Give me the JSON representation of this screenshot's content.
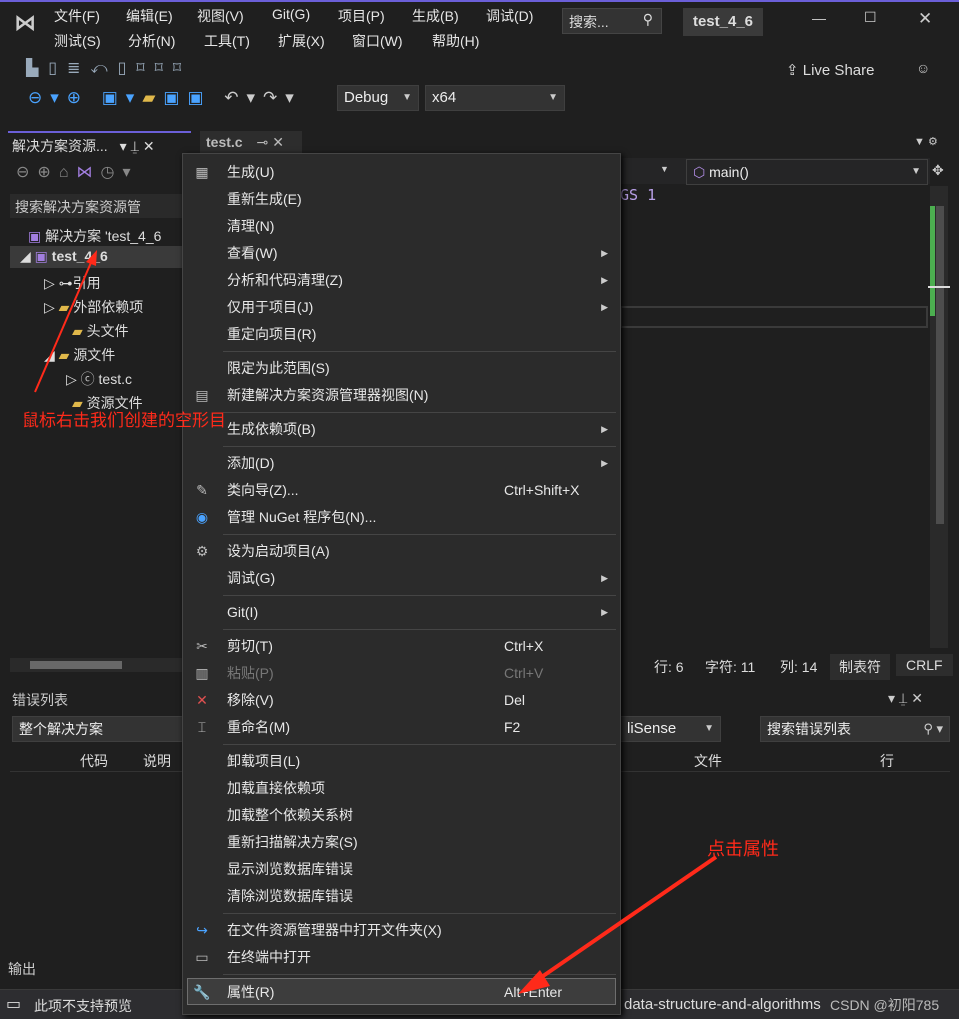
{
  "app": {
    "title": "test_4_6",
    "search_placeholder": "搜索...",
    "live_share": "Live Share"
  },
  "menubar": [
    "文件(F)",
    "编辑(E)",
    "视图(V)",
    "Git(G)",
    "项目(P)",
    "生成(B)",
    "调试(D)",
    "测试(S)",
    "分析(N)",
    "工具(T)",
    "扩展(X)",
    "窗口(W)",
    "帮助(H)"
  ],
  "toolbar": {
    "config": "Debug",
    "platform": "x64"
  },
  "solution_explorer": {
    "tab": "解决方案资源...",
    "search_placeholder": "搜索解决方案资源管",
    "items": [
      "解决方案 'test_4_6",
      "test_4_6",
      "引用",
      "外部依赖项",
      "头文件",
      "源文件",
      "test.c",
      "资源文件"
    ]
  },
  "editor": {
    "tab": "test.c",
    "nav_right": "main()",
    "code_fragment": "GS 1",
    "status": {
      "line": "行: 6",
      "char": "字符: 11",
      "col": "列: 14",
      "tabs": "制表符",
      "eol": "CRLF"
    }
  },
  "error_list": {
    "title": "错误列表",
    "scope": "整个解决方案",
    "source": "liSense",
    "search_placeholder": "搜索错误列表",
    "columns": [
      "代码",
      "说明",
      "文件",
      "行"
    ]
  },
  "output": {
    "title": "输出"
  },
  "statusbar": {
    "text": "此项不支持预览",
    "repo": "data-structure-and-algorithms"
  },
  "watermark": "CSDN @初阳785",
  "annotations": {
    "right_click": "鼠标右击我们创建的空形目",
    "click_props": "点击属性",
    "color": "#ff2a1a"
  },
  "context_menu": [
    {
      "label": "生成(U)",
      "icon": "build-icon"
    },
    {
      "label": "重新生成(E)"
    },
    {
      "label": "清理(N)"
    },
    {
      "label": "查看(W)",
      "sub": true
    },
    {
      "label": "分析和代码清理(Z)",
      "sub": true
    },
    {
      "label": "仅用于项目(J)",
      "sub": true
    },
    {
      "label": "重定向项目(R)"
    },
    {
      "sep": true
    },
    {
      "label": "限定为此范围(S)"
    },
    {
      "label": "新建解决方案资源管理器视图(N)",
      "icon": "new-view-icon"
    },
    {
      "sep": true
    },
    {
      "label": "生成依赖项(B)",
      "sub": true
    },
    {
      "sep": true
    },
    {
      "label": "添加(D)",
      "sub": true
    },
    {
      "label": "类向导(Z)...",
      "shortcut": "Ctrl+Shift+X",
      "icon": "class-wizard-icon"
    },
    {
      "label": "管理 NuGet 程序包(N)...",
      "icon": "nuget-icon"
    },
    {
      "sep": true
    },
    {
      "label": "设为启动项目(A)",
      "icon": "gear-icon"
    },
    {
      "label": "调试(G)",
      "sub": true
    },
    {
      "sep": true
    },
    {
      "label": "Git(I)",
      "sub": true
    },
    {
      "sep": true
    },
    {
      "label": "剪切(T)",
      "shortcut": "Ctrl+X",
      "icon": "scissors-icon"
    },
    {
      "label": "粘贴(P)",
      "shortcut": "Ctrl+V",
      "icon": "paste-icon",
      "disabled": true
    },
    {
      "label": "移除(V)",
      "shortcut": "Del",
      "icon": "remove-icon"
    },
    {
      "label": "重命名(M)",
      "shortcut": "F2",
      "icon": "rename-icon"
    },
    {
      "sep": true
    },
    {
      "label": "卸载项目(L)"
    },
    {
      "label": "加载直接依赖项"
    },
    {
      "label": "加载整个依赖关系树"
    },
    {
      "label": "重新扫描解决方案(S)"
    },
    {
      "label": "显示浏览数据库错误"
    },
    {
      "label": "清除浏览数据库错误"
    },
    {
      "sep": true
    },
    {
      "label": "在文件资源管理器中打开文件夹(X)",
      "icon": "open-folder-icon"
    },
    {
      "label": "在终端中打开",
      "icon": "terminal-icon"
    },
    {
      "sep": true
    },
    {
      "label": "属性(R)",
      "shortcut": "Alt+Enter",
      "icon": "wrench-icon",
      "highlight": true
    }
  ]
}
